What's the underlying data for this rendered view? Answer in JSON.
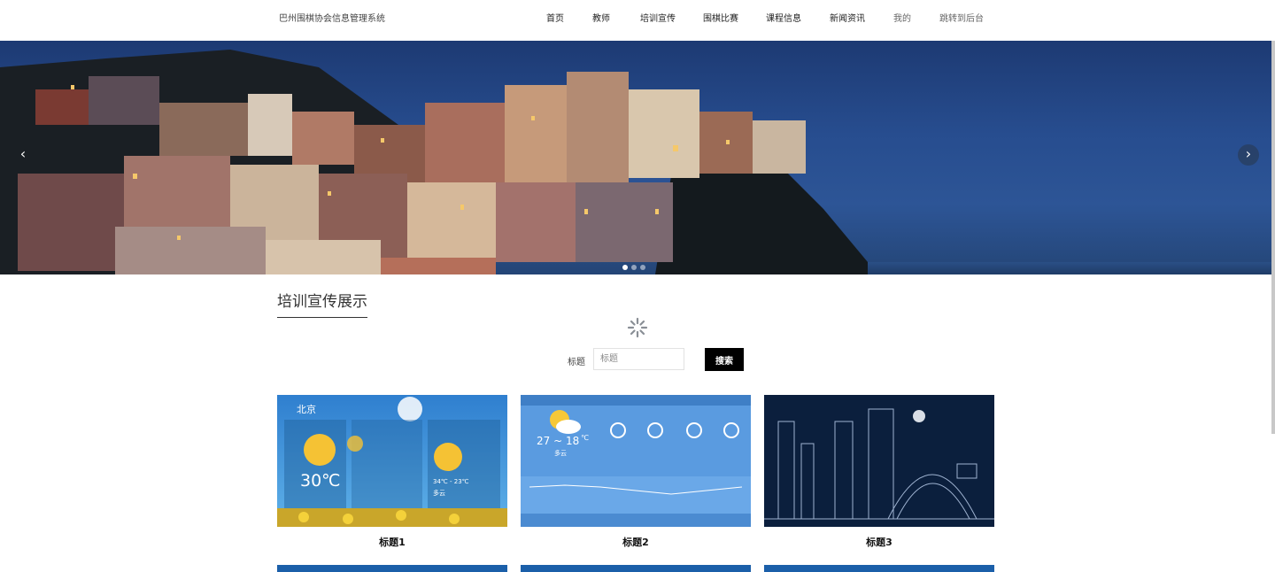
{
  "header": {
    "site_title": "巴州围棋协会信息管理系统",
    "nav": [
      {
        "label": "首页"
      },
      {
        "label": "教师"
      },
      {
        "label": "培训宣传"
      },
      {
        "label": "围棋比赛"
      },
      {
        "label": "课程信息"
      },
      {
        "label": "新闻资讯"
      },
      {
        "label": "我的"
      },
      {
        "label": "跳转到后台"
      }
    ]
  },
  "banner": {
    "prev_icon": "chevron-left-icon",
    "next_icon": "chevron-right-icon",
    "slides": 3,
    "active_slide": 1
  },
  "section": {
    "title": "培训宣传展示"
  },
  "search": {
    "label": "标题",
    "placeholder": "标题",
    "button_label": "搜索"
  },
  "cards": [
    {
      "title": "标题1",
      "thumb": {
        "city": "北京",
        "temp": "30℃",
        "range": "34℃ - 23℃",
        "weather": "多云"
      }
    },
    {
      "title": "标题2",
      "thumb": {
        "temp_range": "27 ~ 18",
        "unit": "℃",
        "weather": "多云"
      }
    },
    {
      "title": "标题3"
    }
  ],
  "colors": {
    "accent": "#000000",
    "banner_sky": "#2d5596"
  }
}
